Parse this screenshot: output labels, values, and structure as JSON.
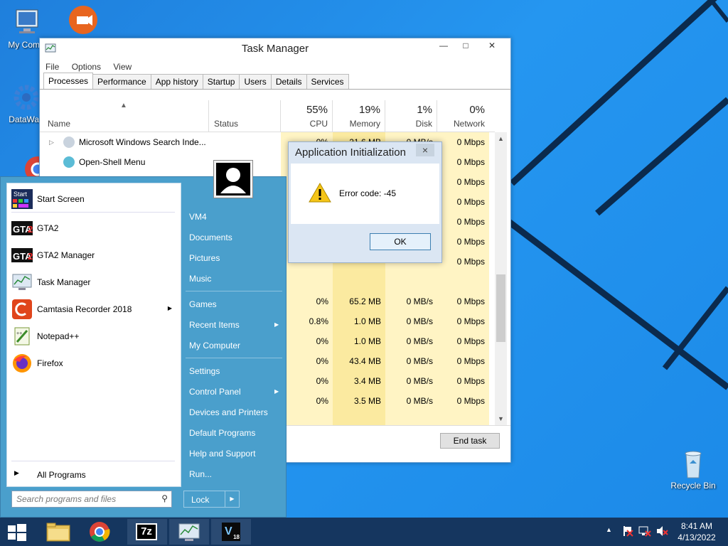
{
  "desktop": {
    "icons": [
      {
        "label": "My Comp"
      },
      {
        "label": ""
      },
      {
        "label": "DataWag"
      },
      {
        "label": "Recycle Bin"
      }
    ]
  },
  "taskmgr": {
    "title": "Task Manager",
    "menu": [
      "File",
      "Options",
      "View"
    ],
    "tabs": [
      "Processes",
      "Performance",
      "App history",
      "Startup",
      "Users",
      "Details",
      "Services"
    ],
    "columns": {
      "name": "Name",
      "status": "Status",
      "cpu": {
        "pct": "55%",
        "label": "CPU"
      },
      "memory": {
        "pct": "19%",
        "label": "Memory"
      },
      "disk": {
        "pct": "1%",
        "label": "Disk"
      },
      "network": {
        "pct": "0%",
        "label": "Network"
      }
    },
    "rows": [
      {
        "name": "Microsoft Windows Search Inde...",
        "cpu": "0%",
        "mem": "21.6 MB",
        "disk": "0 MB/s",
        "net": "0 Mbps"
      },
      {
        "name": "Open-Shell Menu",
        "cpu": "",
        "mem": "",
        "disk": "",
        "net": "0 Mbps"
      },
      {
        "name": "",
        "cpu": "",
        "mem": "",
        "disk": "",
        "net": "0 Mbps"
      },
      {
        "name": "",
        "cpu": "",
        "mem": "",
        "disk": "",
        "net": "0 Mbps"
      },
      {
        "name": "",
        "cpu": "",
        "mem": "",
        "disk": "",
        "net": "0 Mbps"
      },
      {
        "name": "",
        "cpu": "",
        "mem": "",
        "disk": "",
        "net": "0 Mbps"
      },
      {
        "name": "",
        "cpu": "",
        "mem": "",
        "disk": "",
        "net": "0 Mbps"
      },
      {
        "name": "",
        "cpu": "",
        "mem": "",
        "disk": "",
        "net": ""
      },
      {
        "name": "",
        "cpu": "0%",
        "mem": "65.2 MB",
        "disk": "0 MB/s",
        "net": "0 Mbps"
      },
      {
        "name": "",
        "cpu": "0.8%",
        "mem": "1.0 MB",
        "disk": "0 MB/s",
        "net": "0 Mbps"
      },
      {
        "name": "",
        "cpu": "0%",
        "mem": "1.0 MB",
        "disk": "0 MB/s",
        "net": "0 Mbps"
      },
      {
        "name": "",
        "cpu": "0%",
        "mem": "43.4 MB",
        "disk": "0 MB/s",
        "net": "0 Mbps"
      },
      {
        "name": "",
        "cpu": "0%",
        "mem": "3.4 MB",
        "disk": "0 MB/s",
        "net": "0 Mbps"
      },
      {
        "name": "",
        "cpu": "0%",
        "mem": "3.5 MB",
        "disk": "0 MB/s",
        "net": "0 Mbps"
      }
    ],
    "end_task": "End task"
  },
  "dialog": {
    "title": "Application Initialization",
    "close": "×",
    "message": "Error code: -45",
    "ok": "OK"
  },
  "startmenu": {
    "programs": [
      {
        "label": "Start Screen",
        "icon": "start-screen-icon"
      },
      {
        "label": "GTA2",
        "icon": "gta2-icon"
      },
      {
        "label": "GTA2 Manager",
        "icon": "gta2-manager-icon"
      },
      {
        "label": "Task Manager",
        "icon": "task-manager-icon"
      },
      {
        "label": "Camtasia Recorder 2018",
        "icon": "camtasia-icon"
      },
      {
        "label": "Notepad++",
        "icon": "notepadpp-icon"
      },
      {
        "label": "Firefox",
        "icon": "firefox-icon"
      }
    ],
    "all_programs": "All Programs",
    "search_placeholder": "Search programs and files",
    "right": {
      "user": "VM4",
      "documents": "Documents",
      "pictures": "Pictures",
      "music": "Music",
      "games": "Games",
      "recent": "Recent Items",
      "computer": "My Computer",
      "settings": "Settings",
      "control_panel": "Control Panel",
      "devices": "Devices and Printers",
      "default_programs": "Default Programs",
      "help": "Help and Support",
      "run": "Run..."
    },
    "lock": "Lock"
  },
  "taskbar": {
    "time": "8:41 AM",
    "date": "4/13/2022",
    "sevenzip": "7z",
    "v_badge": "V",
    "v_version": "18"
  }
}
